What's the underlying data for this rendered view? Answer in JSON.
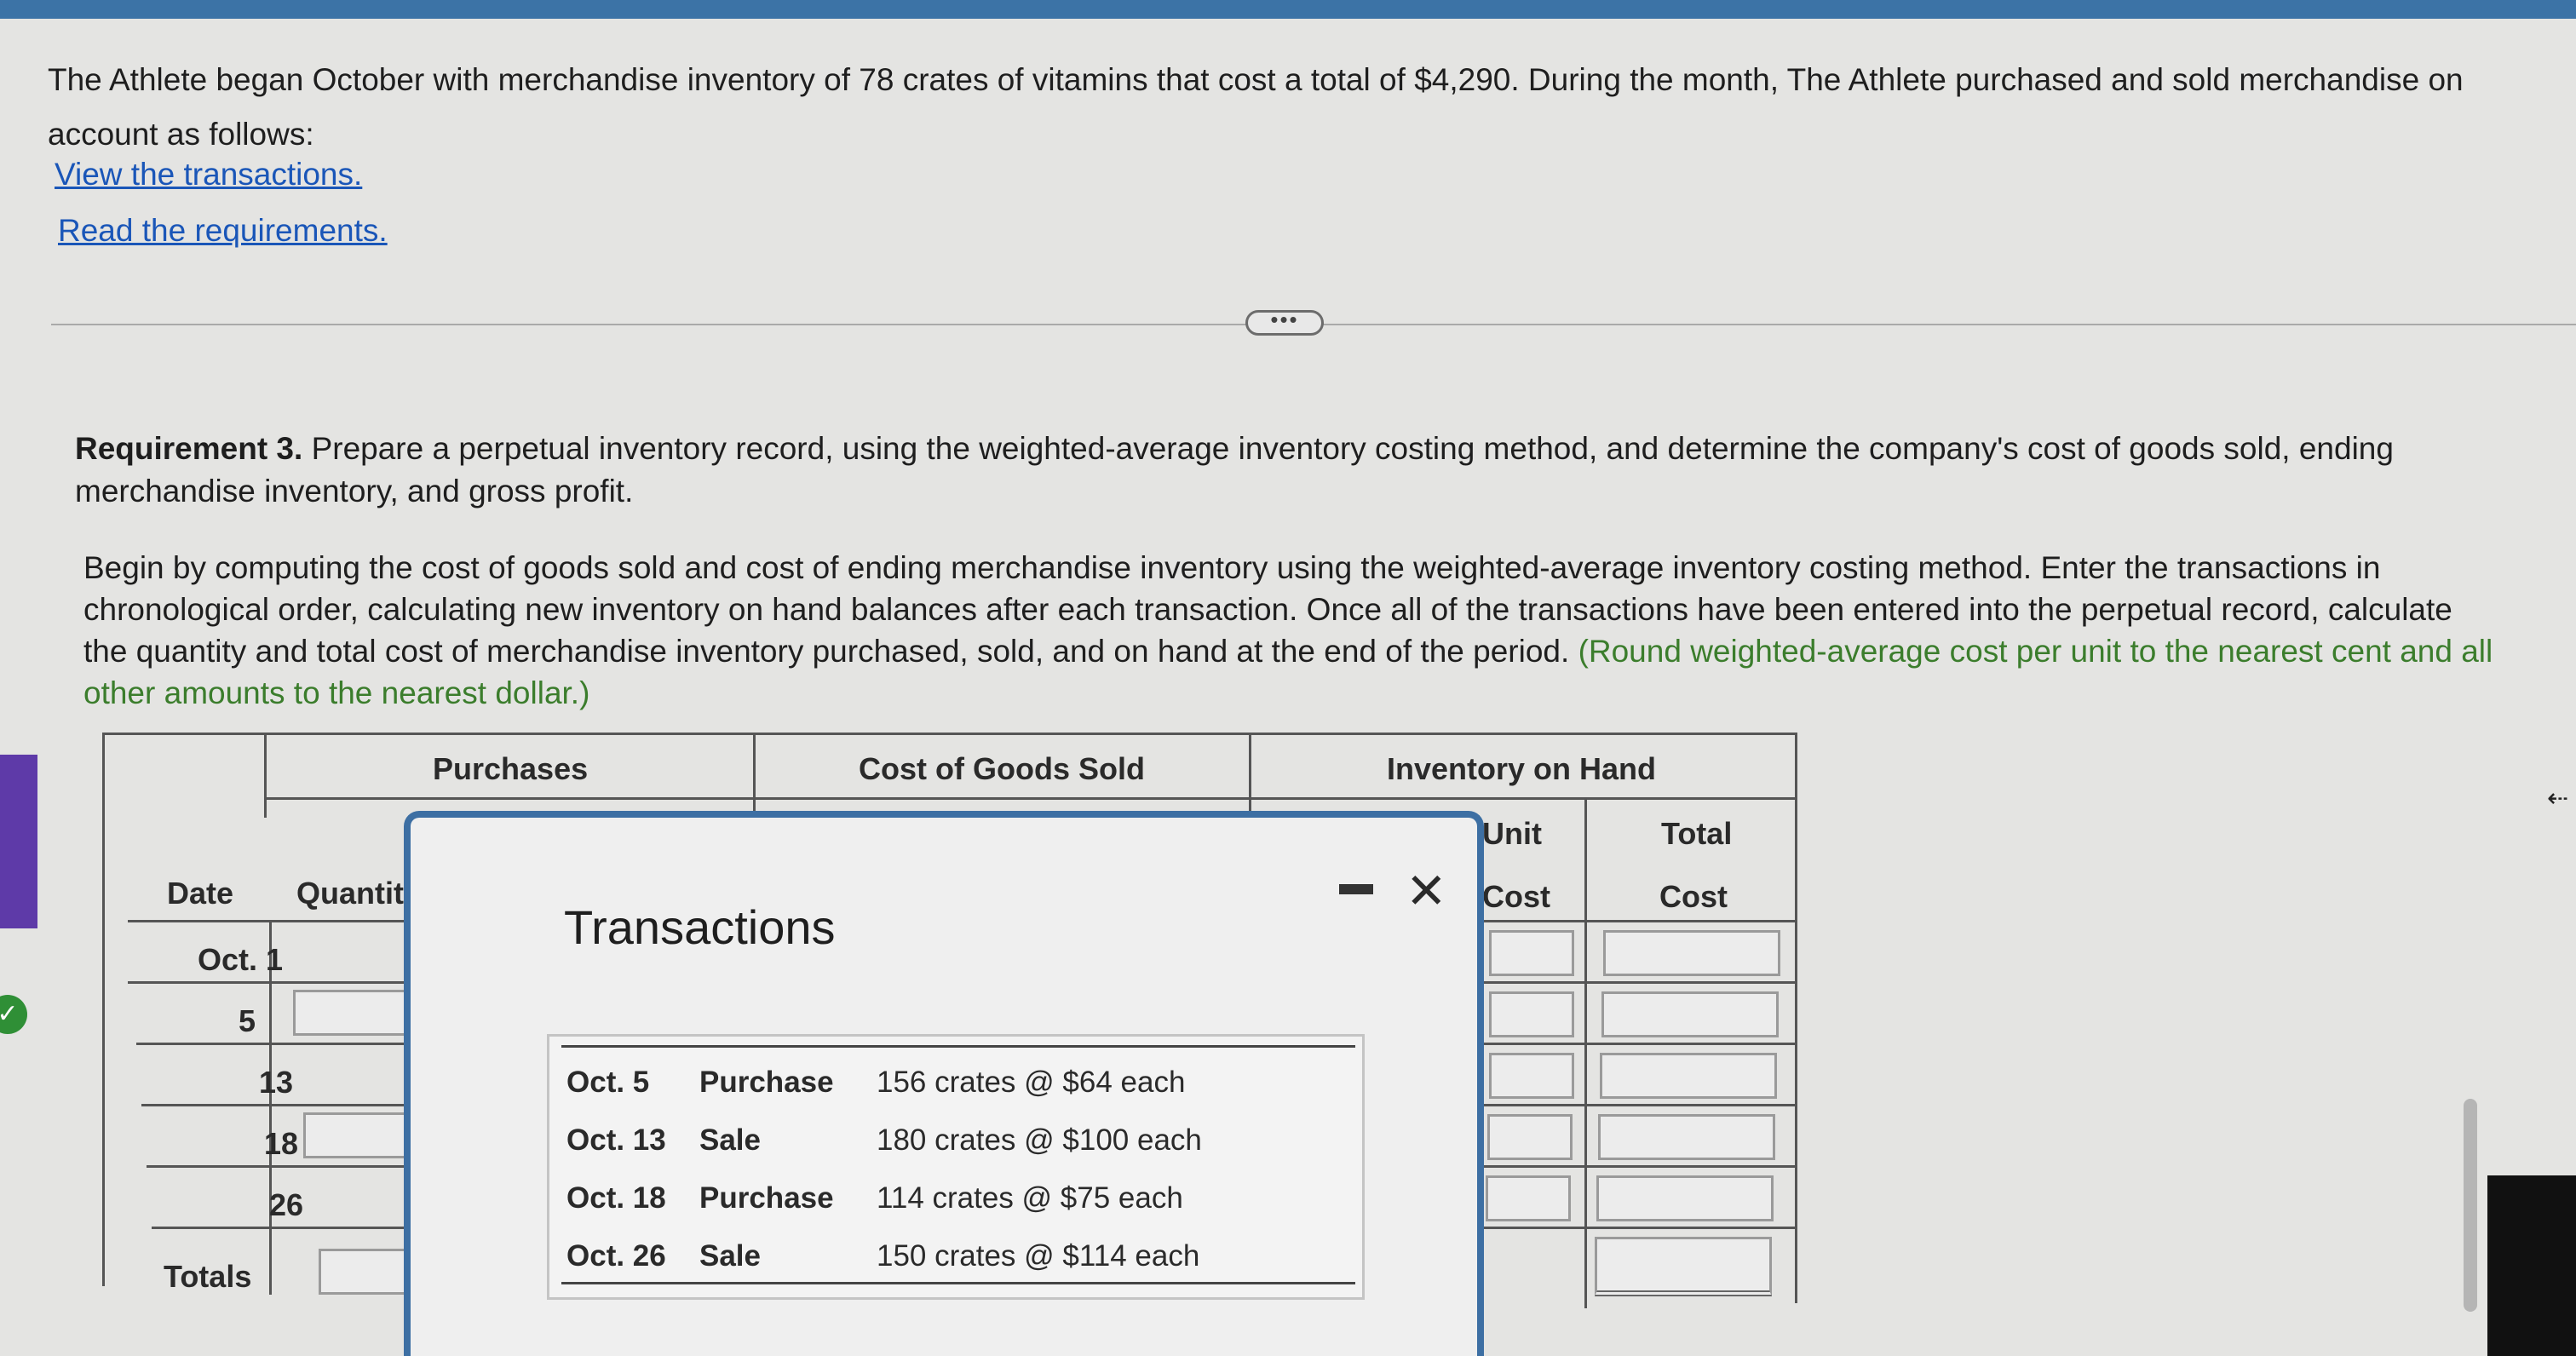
{
  "intro": {
    "text": "The Athlete began October with merchandise inventory of 78 crates of vitamins that cost a total of $4,290. During the month, The Athlete purchased and sold merchandise on account as follows:",
    "links": [
      "View the transactions.",
      "Read the requirements."
    ]
  },
  "expander": "•••",
  "requirement": {
    "label": "Requirement 3.",
    "text": "Prepare a perpetual inventory record, using the weighted-average inventory costing method, and determine the company's cost of goods sold, ending merchandise inventory, and gross profit."
  },
  "instructions": {
    "text": "Begin by computing the cost of goods sold and cost of ending merchandise inventory using the weighted-average inventory costing method. Enter the transactions in chronological order, calculating new inventory on hand balances after each transaction. Once all of the transactions have been entered into the perpetual record, calculate the quantity and total cost of merchandise inventory purchased, sold, and on hand at the end of the period.",
    "note": "(Round weighted-average cost per unit to the nearest cent and all other amounts to the nearest dollar.)"
  },
  "table": {
    "group_headers": [
      "Purchases",
      "Cost of Goods Sold",
      "Inventory on Hand"
    ],
    "sub_headers": {
      "date": "Date",
      "quantity": "Quantity",
      "unit_cost_1": "Unit",
      "unit_cost_2": "Cost",
      "total_cost_1": "Total",
      "total_cost_2": "Cost"
    },
    "rows": [
      "Oct. 1",
      "5",
      "13",
      "18",
      "26"
    ],
    "totals_label": "Totals"
  },
  "popup": {
    "title": "Transactions",
    "transactions": [
      {
        "date": "Oct. 5",
        "type": "Purchase",
        "detail": "156 crates @ $64 each"
      },
      {
        "date": "Oct. 13",
        "type": "Sale",
        "detail": "180 crates @ $100 each"
      },
      {
        "date": "Oct. 18",
        "type": "Purchase",
        "detail": "114 crates @ $75 each"
      },
      {
        "date": "Oct. 26",
        "type": "Sale",
        "detail": "150 crates @ $114 each"
      }
    ]
  }
}
